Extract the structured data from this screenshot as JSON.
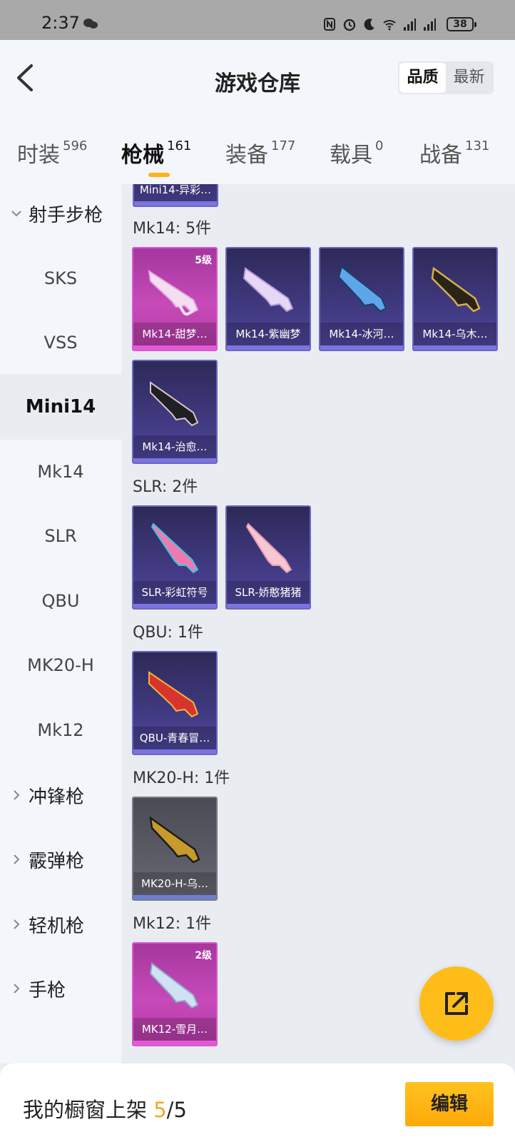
{
  "status_bar": {
    "time": "2:37",
    "battery": "38"
  },
  "header": {
    "title": "游戏仓库",
    "sort_options": [
      "品质",
      "最新"
    ],
    "active_sort": "品质"
  },
  "tabs": [
    {
      "label": "时装",
      "count": "596"
    },
    {
      "label": "枪械",
      "count": "161"
    },
    {
      "label": "装备",
      "count": "177"
    },
    {
      "label": "载具",
      "count": "0"
    },
    {
      "label": "战备",
      "count": "131"
    }
  ],
  "sidebar": {
    "group_open": "射手步枪",
    "items": [
      "SKS",
      "VSS",
      "Mini14",
      "Mk14",
      "SLR",
      "QBU",
      "MK20-H",
      "Mk12"
    ],
    "active_item": "Mini14",
    "collapsed_groups": [
      "冲锋枪",
      "霰弹枪",
      "轻机枪",
      "手枪"
    ]
  },
  "content": {
    "top_partial_card": "Mini14-异彩…",
    "groups": [
      {
        "label": "Mk14: 5件",
        "cards": [
          {
            "name": "Mk14-甜梦…",
            "badge": "5级",
            "rarity": "pink"
          },
          {
            "name": "Mk14-紫幽梦",
            "badge": "",
            "rarity": "purple"
          },
          {
            "name": "Mk14-冰河…",
            "badge": "",
            "rarity": "purple"
          },
          {
            "name": "Mk14-乌木…",
            "badge": "",
            "rarity": "purple"
          },
          {
            "name": "Mk14-治愈…",
            "badge": "",
            "rarity": "purple"
          }
        ]
      },
      {
        "label": "SLR: 2件",
        "cards": [
          {
            "name": "SLR-彩虹符号",
            "badge": "",
            "rarity": "purple"
          },
          {
            "name": "SLR-娇憨猪猪",
            "badge": "",
            "rarity": "purple"
          }
        ]
      },
      {
        "label": "QBU: 1件",
        "cards": [
          {
            "name": "QBU-青春冒…",
            "badge": "",
            "rarity": "purple"
          }
        ]
      },
      {
        "label": "MK20-H: 1件",
        "cards": [
          {
            "name": "MK20-H-乌…",
            "badge": "",
            "rarity": "grey"
          }
        ]
      },
      {
        "label": "Mk12: 1件",
        "cards": [
          {
            "name": "MK12-雪月…",
            "badge": "2级",
            "rarity": "pink"
          }
        ]
      }
    ]
  },
  "footer": {
    "text_prefix": "我的橱窗上架 ",
    "current": "5",
    "separator": "/",
    "total": "5",
    "edit_label": "编辑"
  },
  "colors": {
    "accent": "#ffb21a",
    "pink_rarity": "#c64ab8",
    "purple_rarity": "#413a82"
  }
}
